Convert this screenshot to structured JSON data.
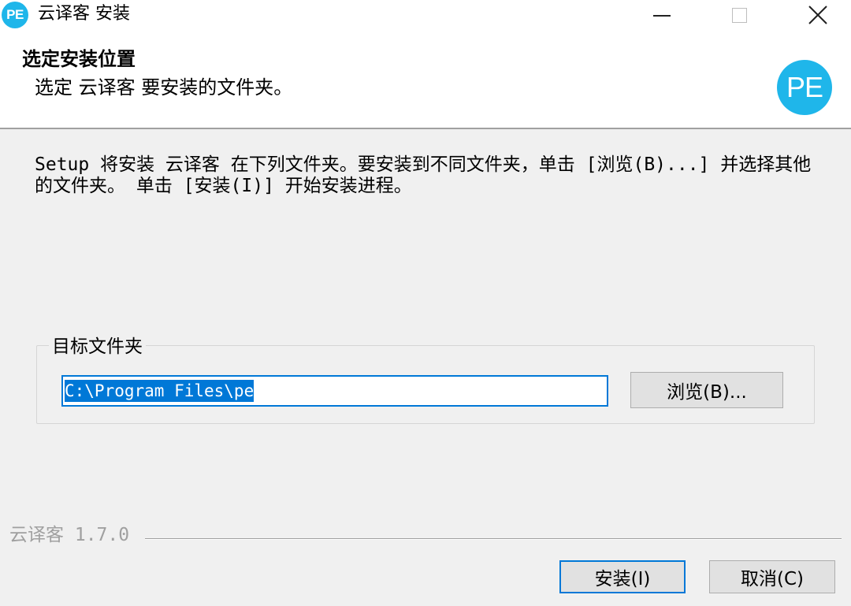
{
  "window": {
    "logo_text": "PE",
    "title": "云译客 安装"
  },
  "header": {
    "title": "选定安装位置",
    "subtitle": "选定 云译客 要安装的文件夹。",
    "logo_text": "PE"
  },
  "body": {
    "description": "Setup 将安装 云译客 在下列文件夹。要安装到不同文件夹，单击 [浏览(B)...] 并选择其他的文件夹。 单击 [安装(I)] 开始安装进程。",
    "destination_group_label": "目标文件夹",
    "destination_path": "C:\\Program Files\\pe",
    "browse_label": "浏览(B)..."
  },
  "footer": {
    "brand": "云译客 1.7.0",
    "install_label": "安装(I)",
    "cancel_label": "取消(C)"
  },
  "colors": {
    "accent": "#0078d7",
    "logo": "#1fb6ea"
  },
  "icons": [
    "minimize-icon",
    "maximize-icon",
    "close-icon"
  ]
}
